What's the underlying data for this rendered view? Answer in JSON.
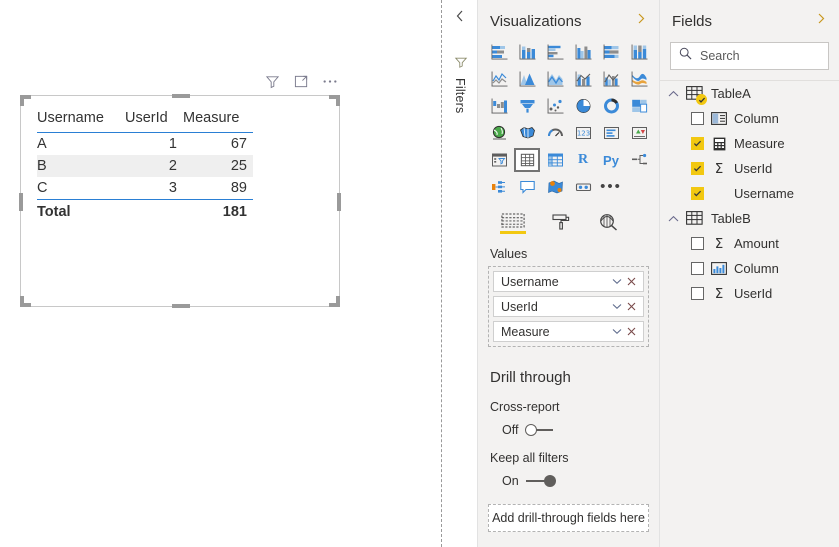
{
  "canvas": {
    "visual": {
      "header_icons": [
        {
          "name": "filter-icon",
          "label": "Filters"
        },
        {
          "name": "focus-mode-icon",
          "label": "Focus mode"
        },
        {
          "name": "more-options-icon",
          "label": "More options"
        }
      ],
      "table": {
        "columns": [
          "Username",
          "UserId",
          "Measure"
        ],
        "rows": [
          {
            "username": "A",
            "userid": "1",
            "measure": "67"
          },
          {
            "username": "B",
            "userid": "2",
            "measure": "25"
          },
          {
            "username": "C",
            "userid": "3",
            "measure": "89"
          }
        ],
        "total": {
          "label": "Total",
          "userid": "",
          "measure": "181"
        }
      }
    }
  },
  "filters_rail": {
    "collapse_label": "Collapse",
    "title": "Filters",
    "icons": {
      "chevron": "chevron-left-icon",
      "funnel": "filter-funnel-icon"
    }
  },
  "visualizations": {
    "title": "Visualizations",
    "expand_label": "Expand",
    "gallery": [
      {
        "name": "stacked-bar-chart-icon",
        "label": "Stacked bar chart",
        "selected": false
      },
      {
        "name": "stacked-column-chart-icon",
        "label": "Stacked column chart",
        "selected": false
      },
      {
        "name": "clustered-bar-chart-icon",
        "label": "Clustered bar chart",
        "selected": false
      },
      {
        "name": "clustered-column-chart-icon",
        "label": "Clustered column chart",
        "selected": false
      },
      {
        "name": "hundred-percent-stacked-bar-chart-icon",
        "label": "100% stacked bar chart",
        "selected": false
      },
      {
        "name": "hundred-percent-stacked-column-chart-icon",
        "label": "100% stacked column chart",
        "selected": false
      },
      {
        "name": "line-chart-icon",
        "label": "Line chart",
        "selected": false
      },
      {
        "name": "area-chart-icon",
        "label": "Area chart",
        "selected": false
      },
      {
        "name": "stacked-area-chart-icon",
        "label": "Stacked area chart",
        "selected": false
      },
      {
        "name": "line-and-stacked-column-chart-icon",
        "label": "Line and stacked column chart",
        "selected": false
      },
      {
        "name": "line-and-clustered-column-chart-icon",
        "label": "Line and clustered column chart",
        "selected": false
      },
      {
        "name": "ribbon-chart-icon",
        "label": "Ribbon chart",
        "selected": false
      },
      {
        "name": "waterfall-chart-icon",
        "label": "Waterfall chart",
        "selected": false
      },
      {
        "name": "funnel-chart-icon",
        "label": "Funnel chart",
        "selected": false
      },
      {
        "name": "scatter-chart-icon",
        "label": "Scatter chart",
        "selected": false
      },
      {
        "name": "pie-chart-icon",
        "label": "Pie chart",
        "selected": false
      },
      {
        "name": "donut-chart-icon",
        "label": "Donut chart",
        "selected": false
      },
      {
        "name": "treemap-icon",
        "label": "Treemap",
        "selected": false
      },
      {
        "name": "map-icon",
        "label": "Map",
        "selected": false
      },
      {
        "name": "filled-map-icon",
        "label": "Filled map",
        "selected": false
      },
      {
        "name": "gauge-icon",
        "label": "Gauge",
        "selected": false
      },
      {
        "name": "card-icon",
        "label": "Card",
        "selected": false
      },
      {
        "name": "multi-row-card-icon",
        "label": "Multi-row card",
        "selected": false
      },
      {
        "name": "kpi-icon",
        "label": "KPI",
        "selected": false
      },
      {
        "name": "slicer-icon",
        "label": "Slicer",
        "selected": false
      },
      {
        "name": "table-icon",
        "label": "Table",
        "selected": true
      },
      {
        "name": "matrix-icon",
        "label": "Matrix",
        "selected": false
      },
      {
        "name": "r-script-visual-icon",
        "label": "R script visual",
        "selected": false
      },
      {
        "name": "python-visual-icon",
        "label": "Python visual",
        "selected": false
      },
      {
        "name": "decomposition-tree-icon",
        "label": "Decomposition tree",
        "selected": false
      },
      {
        "name": "key-influencers-icon",
        "label": "Key influencers",
        "selected": false
      },
      {
        "name": "smart-narrative-icon",
        "label": "Smart narrative",
        "selected": false
      },
      {
        "name": "arcgis-map-icon",
        "label": "ArcGIS Maps for Power BI",
        "selected": false
      },
      {
        "name": "paginated-report-icon",
        "label": "Paginated report",
        "selected": false
      },
      {
        "name": "more-visuals-icon",
        "label": "…",
        "selected": false
      }
    ],
    "tabs": [
      {
        "name": "fields-tab",
        "icon": "fields-pane-icon",
        "label": "Fields",
        "active": true
      },
      {
        "name": "format-tab",
        "icon": "paint-roller-icon",
        "label": "Format",
        "active": false
      },
      {
        "name": "analytics-tab",
        "icon": "analytics-magnifier-icon",
        "label": "Analytics",
        "active": false
      }
    ],
    "wells": [
      {
        "title": "Values",
        "fields": [
          {
            "label": "Username"
          },
          {
            "label": "UserId"
          },
          {
            "label": "Measure"
          }
        ]
      }
    ],
    "drill_through": {
      "title": "Drill through",
      "cross_report": {
        "label": "Cross-report",
        "state": "Off",
        "on": false
      },
      "keep_all_filters": {
        "label": "Keep all filters",
        "state": "On",
        "on": true
      },
      "drop_zone": "Add drill-through fields here"
    }
  },
  "fields": {
    "title": "Fields",
    "expand_label": "Expand",
    "search": {
      "placeholder": "Search",
      "value": ""
    },
    "tables": [
      {
        "name": "TableA",
        "expanded": true,
        "has_badge": true,
        "items": [
          {
            "label": "Column",
            "checked": false,
            "icon": "date-table-column-icon"
          },
          {
            "label": "Measure",
            "checked": true,
            "icon": "calculator-icon"
          },
          {
            "label": "UserId",
            "checked": true,
            "icon": "sigma-icon"
          },
          {
            "label": "Username",
            "checked": true,
            "icon": "none"
          }
        ]
      },
      {
        "name": "TableB",
        "expanded": true,
        "has_badge": false,
        "items": [
          {
            "label": "Amount",
            "checked": false,
            "icon": "sigma-icon"
          },
          {
            "label": "Column",
            "checked": false,
            "icon": "chart-column-icon"
          },
          {
            "label": "UserId",
            "checked": false,
            "icon": "sigma-icon"
          }
        ]
      }
    ]
  },
  "colors": {
    "accent_yellow": "#F2C811",
    "table_header_rule": "#2A7FD4",
    "pane_background": "#F3F2F1",
    "icon_blue": "#3B8AD8",
    "icon_gray": "#5E5E5E"
  }
}
